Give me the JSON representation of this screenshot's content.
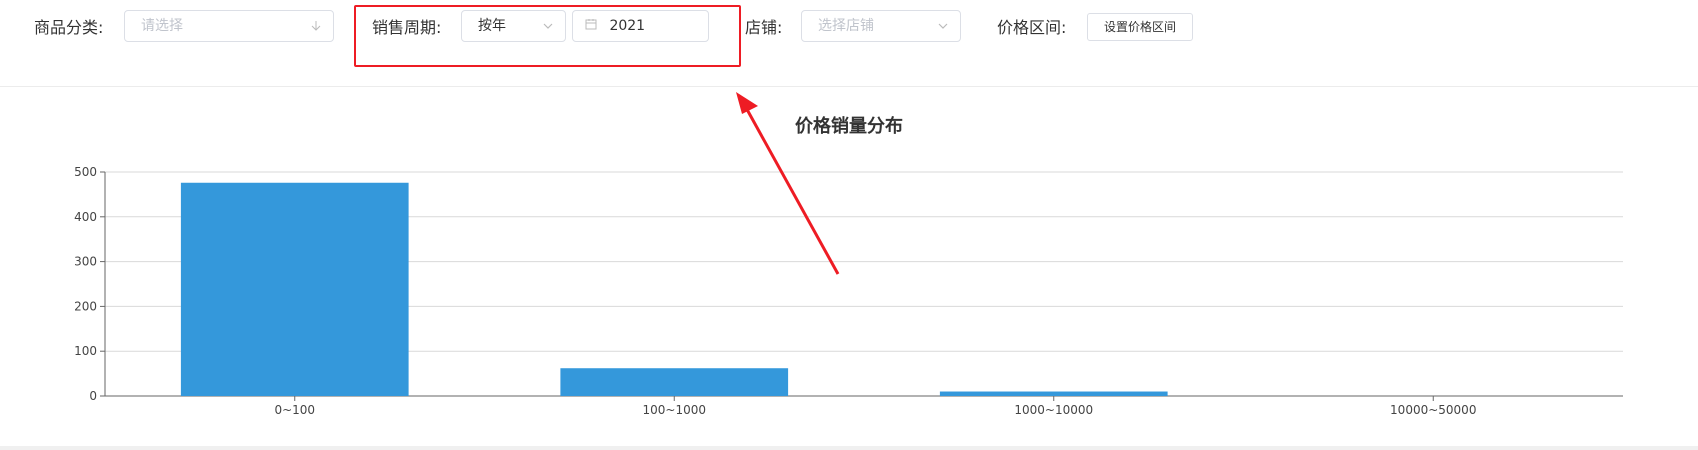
{
  "filters": {
    "category_label": "商品分类:",
    "category_placeholder": "请选择",
    "period_label": "销售周期:",
    "period_value": "按年",
    "year_value": "2021",
    "store_label": "店铺:",
    "store_placeholder": "选择店铺",
    "price_label": "价格区间:",
    "price_button": "设置价格区间"
  },
  "annotation": {
    "color": "#ee1c24"
  },
  "colors": {
    "bar": "#3498db"
  },
  "chart_data": {
    "type": "bar",
    "title": "价格销量分布",
    "categories": [
      "0~100",
      "100~1000",
      "1000~10000",
      "10000~50000"
    ],
    "values": [
      476,
      62,
      10,
      0
    ],
    "ylim": [
      0,
      500
    ],
    "yticks": [
      0,
      100,
      200,
      300,
      400,
      500
    ],
    "xlabel": "",
    "ylabel": "",
    "grid": true
  }
}
